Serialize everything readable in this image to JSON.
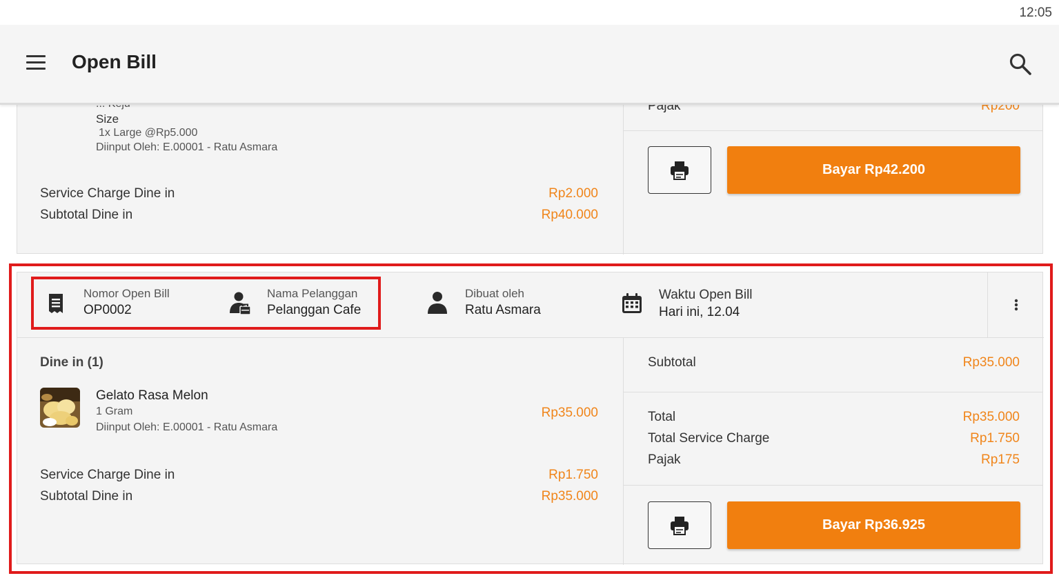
{
  "status": {
    "time": "12:05"
  },
  "appbar": {
    "title": "Open Bill"
  },
  "icons": {
    "menu": "hamburger-menu-icon",
    "search": "search-icon",
    "print": "printer-icon",
    "more": "more-vertical-icon",
    "bill": "receipt-icon",
    "customer": "person-bag-icon",
    "creator": "person-icon",
    "time": "calendar-icon"
  },
  "colors": {
    "accent": "#f17f0f",
    "price": "#f0851a",
    "highlight": "#e01b1b"
  },
  "card1": {
    "partial_top": "... Keju",
    "size_label": "Size",
    "size_value": "1x Large @Rp5.000",
    "input_by": "Diinput Oleh:  E.00001 - Ratu Asmara",
    "service_label": "Service Charge Dine in",
    "service_value": "Rp2.000",
    "subtotal_label": "Subtotal Dine in",
    "subtotal_value": "Rp40.000",
    "pajak_label": "Pajak",
    "pajak_value": "Rp200",
    "pay_label": "Bayar Rp42.200"
  },
  "card2": {
    "header": {
      "bill_no_label": "Nomor Open Bill",
      "bill_no_value": "OP0002",
      "customer_label": "Nama Pelanggan",
      "customer_value": "Pelanggan Cafe",
      "creator_label": "Dibuat oleh",
      "creator_value": "Ratu Asmara",
      "time_label": "Waktu Open Bill",
      "time_value": "Hari ini, 12.04"
    },
    "section_title": "Dine in (1)",
    "item": {
      "name": "Gelato Rasa Melon",
      "qty": "1 Gram",
      "input_by": "Diinput Oleh:  E.00001 - Ratu Asmara",
      "price": "Rp35.000"
    },
    "service_label": "Service Charge Dine in",
    "service_value": "Rp1.750",
    "subtotal_label": "Subtotal Dine in",
    "subtotal_value": "Rp35.000",
    "summary": {
      "subtotal_label": "Subtotal",
      "subtotal_value": "Rp35.000",
      "total_label": "Total",
      "total_value": "Rp35.000",
      "service_label": "Total Service Charge",
      "service_value": "Rp1.750",
      "pajak_label": "Pajak",
      "pajak_value": "Rp175"
    },
    "pay_label": "Bayar Rp36.925"
  }
}
